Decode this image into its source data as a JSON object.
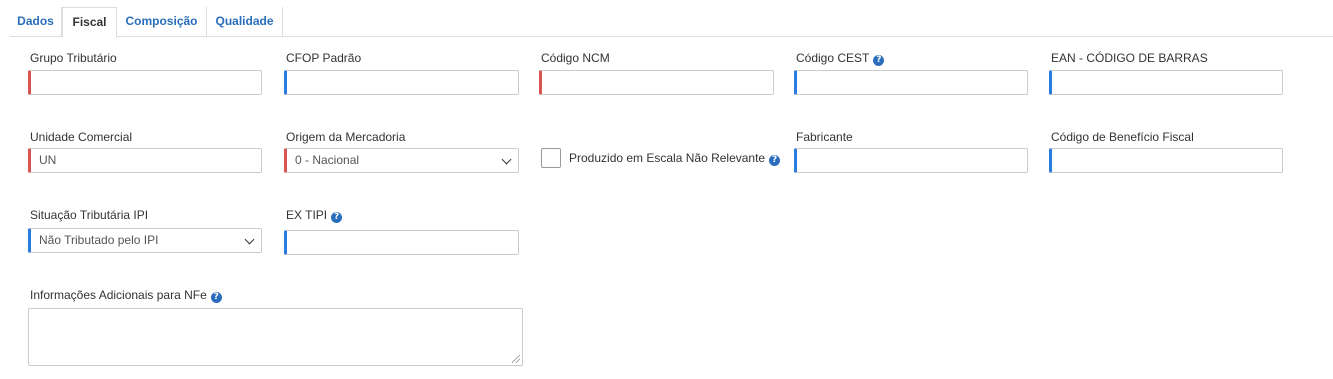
{
  "tabs": [
    {
      "label": "Dados",
      "active": false
    },
    {
      "label": "Fiscal",
      "active": true
    },
    {
      "label": "Composição",
      "active": false
    },
    {
      "label": "Qualidade",
      "active": false
    }
  ],
  "fields": {
    "grupo_tributario": {
      "label": "Grupo Tributário",
      "value": ""
    },
    "cfop_padrao": {
      "label": "CFOP Padrão",
      "value": ""
    },
    "codigo_ncm": {
      "label": "Código NCM",
      "value": ""
    },
    "codigo_cest": {
      "label": "Código CEST",
      "value": ""
    },
    "ean": {
      "label": "EAN - CÓDIGO DE BARRAS",
      "value": ""
    },
    "unidade_comercial": {
      "label": "Unidade Comercial",
      "value": "UN"
    },
    "origem_mercadoria": {
      "label": "Origem da Mercadoria",
      "value": "0 - Nacional"
    },
    "escala_nao_relevante": {
      "label": "Produzido em Escala Não Relevante",
      "checked": false
    },
    "fabricante": {
      "label": "Fabricante",
      "value": ""
    },
    "codigo_beneficio": {
      "label": "Código de Benefício Fiscal",
      "value": ""
    },
    "situacao_ipi": {
      "label": "Situação Tributária IPI",
      "value": "Não Tributado pelo IPI"
    },
    "ex_tipi": {
      "label": "EX TIPI",
      "value": ""
    },
    "info_adicionais": {
      "label": "Informações Adicionais para NFe",
      "value": ""
    }
  },
  "colors": {
    "link": "#2a6ebb",
    "required_accent": "#d9534f",
    "optional_accent": "#2a7be0"
  },
  "icons": {
    "help": "question-circle-icon",
    "select": "chevron-down-icon"
  }
}
